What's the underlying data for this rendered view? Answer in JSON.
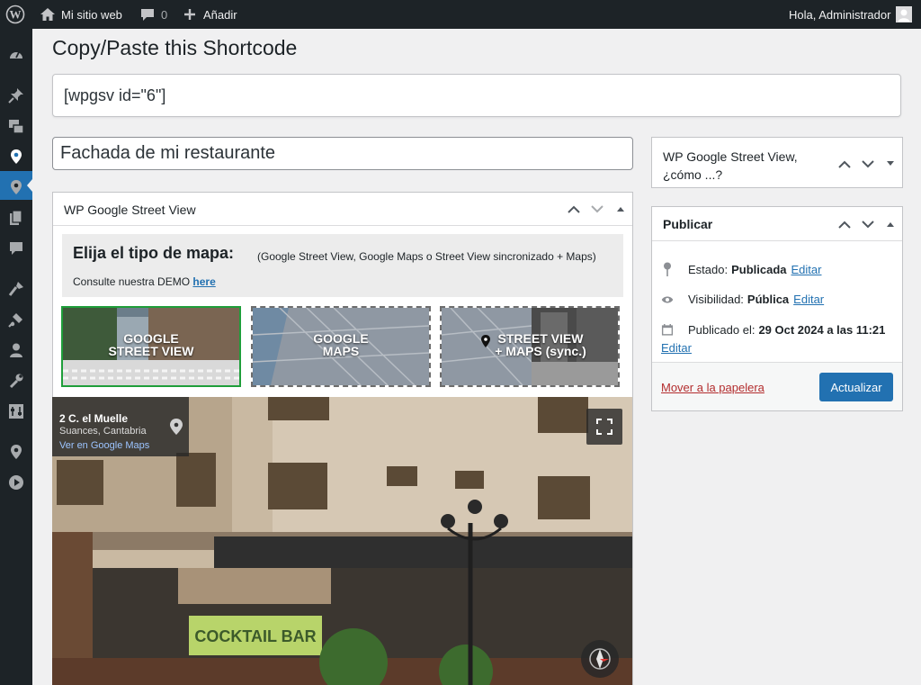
{
  "admin_bar": {
    "site_name": "Mi sitio web",
    "comments_count": "0",
    "new_label": "Añadir",
    "greeting": "Hola, Administrador"
  },
  "sidebar": {
    "icons": [
      "dashboard-icon",
      "pin-icon",
      "media-icon",
      "location-icon-active",
      "location-icon",
      "pages-icon",
      "comments-icon",
      "appearance-icon",
      "plugins-icon",
      "users-icon",
      "tools-icon",
      "settings-icon",
      "location-icon",
      "play-icon"
    ]
  },
  "shortcode": {
    "heading": "Copy/Paste this Shortcode",
    "value": "[wpgsv id=\"6\"]"
  },
  "post": {
    "title": "Fachada de mi restaurante"
  },
  "gsv_box": {
    "title": "WP Google Street View",
    "choose_title": "Elija el tipo de mapa:",
    "choose_subtitle": "(Google Street View, Google Maps o Street View sincronizado + Maps)",
    "demo_text": "Consulte nuestra DEMO",
    "demo_link": "here",
    "tiles": [
      {
        "line1": "GOOGLE",
        "line2": "STREET VIEW",
        "selected": true
      },
      {
        "line1": "GOOGLE",
        "line2": "MAPS",
        "selected": false
      },
      {
        "line1": "STREET VIEW",
        "line2": "+ MAPS (sync.)",
        "selected": false
      }
    ]
  },
  "streetview": {
    "address": "2 C. el Muelle",
    "city": "Suances, Cantabria",
    "maps_link": "Ver en Google Maps"
  },
  "howto_box": {
    "title_line1": "WP Google Street View,",
    "title_line2": "¿cómo ...?"
  },
  "publish_box": {
    "title": "Publicar",
    "status_label": "Estado:",
    "status_value": "Publicada",
    "visibility_label": "Visibilidad:",
    "visibility_value": "Pública",
    "published_label": "Publicado el:",
    "published_value": "29 Oct 2024 a las 11:21",
    "edit_link": "Editar",
    "trash_link": "Mover a la papelera",
    "update_button": "Actualizar"
  },
  "colors": {
    "admin_dark": "#1d2327",
    "accent_blue": "#2271b1",
    "selected_green": "#1f9e3a",
    "trash_red": "#b32d2e"
  }
}
